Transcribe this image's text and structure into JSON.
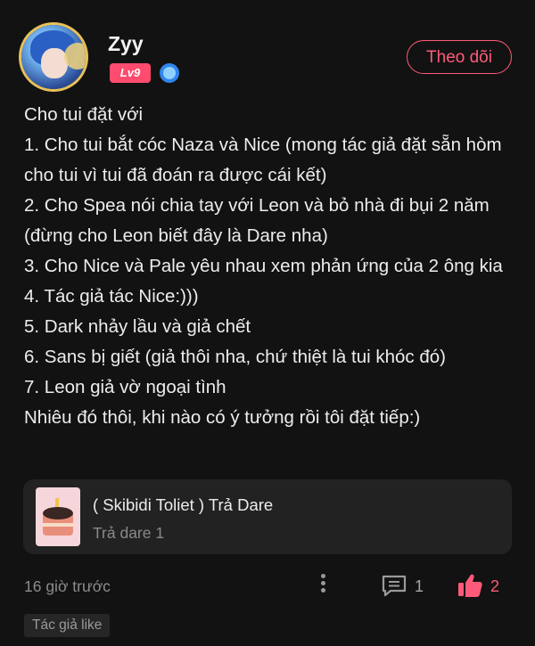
{
  "header": {
    "username": "Zyy",
    "level": "Lv9",
    "follow_label": "Theo dõi"
  },
  "post": {
    "lines": [
      "Cho tui đặt với",
      "1. Cho tui bắt cóc Naza và Nice (mong tác giả đặt sẵn hòm cho tui vì tui đã đoán ra được cái kết)",
      "2. Cho Spea nói chia tay với Leon và bỏ nhà đi bụi 2 năm (đừng cho Leon biết đây là Dare nha)",
      "3. Cho Nice và Pale yêu nhau xem phản ứng của 2 ông kia",
      "4. Tác giả tác Nice:)))",
      "5. Dark nhảy lầu và giả chết",
      "6. Sans bị giết (giả thôi nha, chứ thiệt là tui khóc đó)",
      "7. Leon giả vờ ngoại tình",
      "Nhiêu đó thôi, khi nào có ý tưởng rồi tôi đặt tiếp:)"
    ]
  },
  "linked_story": {
    "title": "( Skibidi Toliet ) Trả Dare",
    "subtitle": "Trả dare 1"
  },
  "footer": {
    "timestamp": "16 giờ trước",
    "comment_count": "1",
    "like_count": "2",
    "author_like_tag": "Tác giả like"
  },
  "colors": {
    "accent": "#ff5a79",
    "level_badge": "#ff4b6e",
    "background": "#121212",
    "card_background": "#222222"
  },
  "icons": {
    "more": "more-vertical-icon",
    "comment": "comment-icon",
    "like": "thumbs-up-icon",
    "verified": "verified-badge-icon"
  }
}
